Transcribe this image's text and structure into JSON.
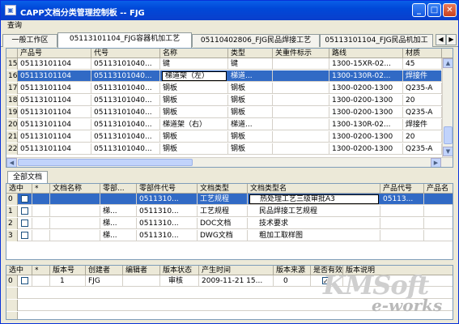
{
  "window": {
    "icon_glyph": "▣",
    "title": "CAPP文档分类管理控制板 -- FJG",
    "btn_min": "_",
    "btn_max": "□",
    "btn_close": "✕"
  },
  "menu": [
    "查询"
  ],
  "top_tabs": [
    {
      "label": "一般工作区"
    },
    {
      "label": "05113101104_FJG容器机加工艺"
    },
    {
      "label": "05110402806_FJG民品焊接工艺"
    },
    {
      "label": "05113101104_FJG民品机加工"
    }
  ],
  "tab_arrows": {
    "left": "◀",
    "right": "▶"
  },
  "part_grid": {
    "columns": [
      "产品号",
      "代号",
      "名称",
      "类型",
      "关重件标示",
      "路线",
      "材质"
    ],
    "rows": [
      {
        "n": "15",
        "product": "05113101104",
        "code": "05113101040...",
        "name": "键",
        "type": "键",
        "mark": "",
        "route": "1300-15XR-02...",
        "material": "45",
        "selected": false
      },
      {
        "n": "16",
        "product": "05113101104",
        "code": "05113101040...",
        "name": "梯道架（左）",
        "type": "梯道...",
        "mark": "",
        "route": "1300-130R-02...",
        "material": "焊接件",
        "selected": true
      },
      {
        "n": "17",
        "product": "05113101104",
        "code": "05113101040...",
        "name": "钢板",
        "type": "钢板",
        "mark": "",
        "route": "1300-0200-1300",
        "material": "Q235-A",
        "selected": false
      },
      {
        "n": "18",
        "product": "05113101104",
        "code": "05113101040...",
        "name": "钢板",
        "type": "钢板",
        "mark": "",
        "route": "1300-0200-1300",
        "material": "20",
        "selected": false
      },
      {
        "n": "19",
        "product": "05113101104",
        "code": "05113101040...",
        "name": "钢板",
        "type": "钢板",
        "mark": "",
        "route": "1300-0200-1300",
        "material": "Q235-A",
        "selected": false
      },
      {
        "n": "20",
        "product": "05113101104",
        "code": "05113101040...",
        "name": "梯道架（右）",
        "type": "梯道...",
        "mark": "",
        "route": "1300-130R-02...",
        "material": "焊接件",
        "selected": false
      },
      {
        "n": "21",
        "product": "05113101104",
        "code": "05113101040...",
        "name": "钢板",
        "type": "钢板",
        "mark": "",
        "route": "1300-0200-1300",
        "material": "20",
        "selected": false
      },
      {
        "n": "22",
        "product": "05113101104",
        "code": "05113101040...",
        "name": "钢板",
        "type": "钢板",
        "mark": "",
        "route": "1300-0200-1300",
        "material": "Q235-A",
        "selected": false
      }
    ]
  },
  "doc_tab": {
    "label": "全部文档"
  },
  "doc_grid": {
    "columns": [
      "选中",
      "*",
      "文档名称",
      "零部...",
      "零部件代号",
      "文档类型",
      "文档类型名",
      "产品代号",
      "产品名"
    ],
    "rows": [
      {
        "n": "0",
        "checked": false,
        "star": "",
        "doc_name": "",
        "part": "",
        "part_code": "0511310...",
        "doc_type": "工艺规程",
        "type_name": "热处理工艺三级审批A3",
        "prod_code": "05113...",
        "selected": true
      },
      {
        "n": "1",
        "checked": false,
        "star": "",
        "doc_name": "",
        "part": "梯...",
        "part_code": "0511310...",
        "doc_type": "工艺规程",
        "type_name": "民品焊接工艺规程",
        "prod_code": "",
        "selected": false
      },
      {
        "n": "2",
        "checked": false,
        "star": "",
        "doc_name": "",
        "part": "梯...",
        "part_code": "0511310...",
        "doc_type": "DOC文档",
        "type_name": "技术要求",
        "prod_code": "",
        "selected": false
      },
      {
        "n": "3",
        "checked": false,
        "star": "",
        "doc_name": "",
        "part": "梯...",
        "part_code": "0511310...",
        "doc_type": "DWG文档",
        "type_name": "粗加工取样图",
        "prod_code": "",
        "selected": false
      }
    ]
  },
  "version_grid": {
    "columns": [
      "选中",
      "*",
      "版本号",
      "创建者",
      "编辑者",
      "版本状态",
      "产生时间",
      "版本来源",
      "是否有效",
      "版本说明"
    ],
    "rows": [
      {
        "n": "0",
        "checked": false,
        "star": "",
        "version": "1",
        "creator": "FJG",
        "editor": "",
        "status": "审核",
        "time": "2009-11-21 15...",
        "source": "0",
        "valid": true,
        "note": ""
      }
    ]
  },
  "scroll": {
    "up": "▲",
    "down": "▼",
    "left": "◀",
    "right": "▶"
  },
  "watermark": {
    "line1": "KMSoft",
    "line2": "e-works"
  }
}
